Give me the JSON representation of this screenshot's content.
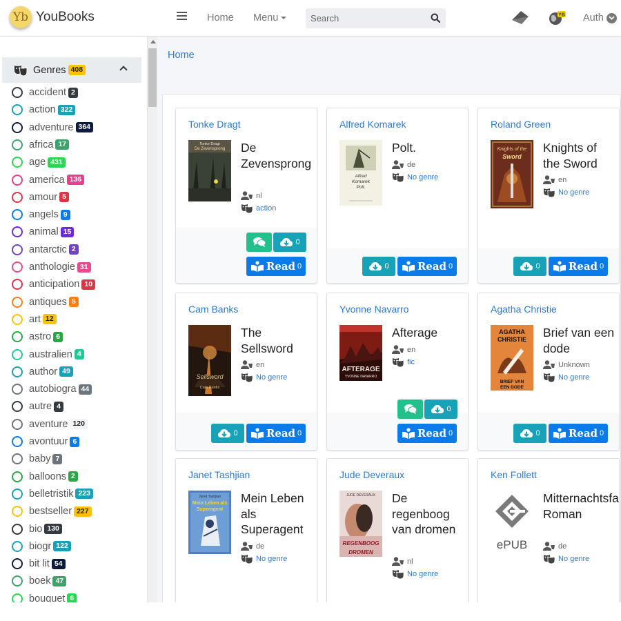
{
  "brand": {
    "logo_text": "Yb",
    "name": "YouBooks"
  },
  "nav": {
    "home": "Home",
    "menu": "Menu",
    "auth": "Auth"
  },
  "search": {
    "placeholder": "Search"
  },
  "sidebar": {
    "title": "Genres",
    "count": "408",
    "items": [
      {
        "label": "accident",
        "count": "2",
        "color": "#343a40"
      },
      {
        "label": "action",
        "count": "322",
        "color": "#17a2b8"
      },
      {
        "label": "adventure",
        "count": "364",
        "color": "#0d1b3e"
      },
      {
        "label": "africa",
        "count": "17",
        "color": "#3ea36b"
      },
      {
        "label": "age",
        "count": "431",
        "color": "#28d94f"
      },
      {
        "label": "america",
        "count": "136",
        "color": "#e83e8c"
      },
      {
        "label": "amour",
        "count": "5",
        "color": "#dc3545"
      },
      {
        "label": "angels",
        "count": "9",
        "color": "#0a7be8"
      },
      {
        "label": "animal",
        "count": "15",
        "color": "#6f2bd8"
      },
      {
        "label": "antarctic",
        "count": "2",
        "color": "#6f42c1"
      },
      {
        "label": "anthologie",
        "count": "31",
        "color": "#e84a8e"
      },
      {
        "label": "anticipation",
        "count": "10",
        "color": "#dc3545"
      },
      {
        "label": "antiques",
        "count": "5",
        "color": "#fd7e14"
      },
      {
        "label": "art",
        "count": "12",
        "color": "#ffc107"
      },
      {
        "label": "astro",
        "count": "6",
        "color": "#28a745"
      },
      {
        "label": "australien",
        "count": "4",
        "color": "#20c997"
      },
      {
        "label": "author",
        "count": "49",
        "color": "#17a2b8"
      },
      {
        "label": "autobiogra",
        "count": "44",
        "color": "#6c757d"
      },
      {
        "label": "autre",
        "count": "4",
        "color": "#343a40"
      },
      {
        "label": "aventure",
        "count": "120",
        "color": "#f1f3f5"
      },
      {
        "label": "avontuur",
        "count": "6",
        "color": "#0a7be8"
      },
      {
        "label": "baby",
        "count": "7",
        "color": "#6c757d"
      },
      {
        "label": "balloons",
        "count": "2",
        "color": "#28a745"
      },
      {
        "label": "belletristik",
        "count": "223",
        "color": "#17a2b8"
      },
      {
        "label": "bestseller",
        "count": "227",
        "color": "#ffc107"
      },
      {
        "label": "bio",
        "count": "130",
        "color": "#343a40"
      },
      {
        "label": "biogr",
        "count": "122",
        "color": "#17a2b8"
      },
      {
        "label": "bit lit",
        "count": "54",
        "color": "#0d1b3e"
      },
      {
        "label": "boek",
        "count": "47",
        "color": "#3ea36b"
      },
      {
        "label": "bouquet",
        "count": "6",
        "color": "#28d94f"
      }
    ]
  },
  "breadcrumb": "Home",
  "books": [
    {
      "author": "Tonke Dragt",
      "title": "De Zevensprong",
      "lang": "nl",
      "genre": "action",
      "cover": "zevensprong",
      "cover_text": [
        "Tonke Dragt",
        "De Zevensprong"
      ]
    },
    {
      "author": "Alfred Komarek",
      "title": "Polt.",
      "lang": "de",
      "genre": "No genre",
      "cover": "polt",
      "cover_text": [
        "Alfred",
        "Komarek",
        "Polt."
      ]
    },
    {
      "author": "Roland Green",
      "title": "Knights of the Sword",
      "lang": "en",
      "genre": "No genre",
      "cover": "knights",
      "cover_text": [
        "Knights of the",
        "Sword"
      ]
    },
    {
      "author": "Cam Banks",
      "title": "The Sellsword",
      "lang": "en",
      "genre": "No genre",
      "cover": "sellsword",
      "cover_text": [
        "Sellsword",
        "Cam Banks"
      ]
    },
    {
      "author": "Yvonne Navarro",
      "title": "Afterage",
      "lang": "en",
      "genre": "fic",
      "cover": "afterage",
      "cover_text": [
        "AFTERAGE",
        "YVONNE NAVARRO"
      ]
    },
    {
      "author": "Agatha Christie",
      "title": "Brief van een dode",
      "lang": "Unknown",
      "genre": "No genre",
      "cover": "christie",
      "cover_text": [
        "AGATHA",
        "CHRISTIE",
        "BRIEF VAN",
        "EEN DODE"
      ]
    },
    {
      "author": "Janet Tashjian",
      "title": "Mein Leben als Superagent",
      "lang": "de",
      "genre": "No genre",
      "cover": "superagent",
      "cover_text": [
        "Janet Tashjian",
        "Mein Leben als",
        "Superagent"
      ]
    },
    {
      "author": "Jude Deveraux",
      "title": "De regenboog van dromen",
      "lang": "nl",
      "genre": "No genre",
      "cover": "regenboog",
      "cover_text": [
        "JUDE DEVERAUX",
        "REGENBOOG",
        "DROMEN"
      ]
    },
    {
      "author": "Ken Follett",
      "title": "Mitternachtsfalken: Roman",
      "lang": "de",
      "genre": "No genre",
      "cover": "epub",
      "cover_text": [
        "ePUB"
      ]
    }
  ],
  "buttons": {
    "read": "Read",
    "zero": "0"
  }
}
